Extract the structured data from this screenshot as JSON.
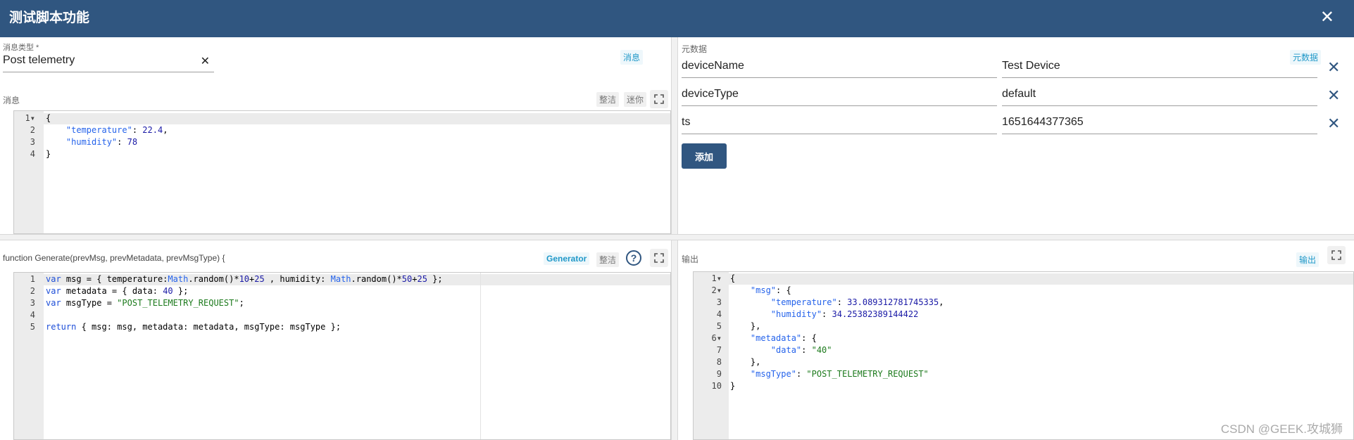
{
  "dialog": {
    "title": "测试脚本功能"
  },
  "msg_type": {
    "label": "消息类型 *",
    "value": "Post telemetry"
  },
  "message_panel": {
    "tag": "消息",
    "label": "消息",
    "tidy_btn": "整洁",
    "mini_btn": "迷你",
    "code_lines": [
      "{",
      "    \"temperature\": 22.4,",
      "    \"humidity\": 78",
      "}"
    ]
  },
  "metadata_panel": {
    "label": "元数据",
    "tag": "元数据",
    "rows": [
      {
        "key": "deviceName",
        "value": "Test Device"
      },
      {
        "key": "deviceType",
        "value": "default"
      },
      {
        "key": "ts",
        "value": "1651644377365"
      }
    ],
    "add_btn": "添加"
  },
  "function_panel": {
    "signature": "function Generate(prevMsg, prevMetadata, prevMsgType) {",
    "tag": "Generator",
    "tidy_btn": "整洁",
    "code_lines": [
      "var msg = { temperature:Math.random()*10+25 , humidity: Math.random()*50+25 };",
      "var metadata = { data: 40 };",
      "var msgType = \"POST_TELEMETRY_REQUEST\";",
      "",
      "return { msg: msg, metadata: metadata, msgType: msgType };"
    ]
  },
  "output_panel": {
    "label": "输出",
    "tag": "输出",
    "code_lines": [
      "{",
      "    \"msg\": {",
      "        \"temperature\": 33.089312781745335,",
      "        \"humidity\": 34.25382389144422",
      "    },",
      "    \"metadata\": {",
      "        \"data\": \"40\"",
      "    },",
      "    \"msgType\": \"POST_TELEMETRY_REQUEST\"",
      "}"
    ]
  },
  "watermark": "CSDN @GEEK.攻城狮",
  "colors": {
    "header": "#305680",
    "accent": "#1f98c8"
  }
}
